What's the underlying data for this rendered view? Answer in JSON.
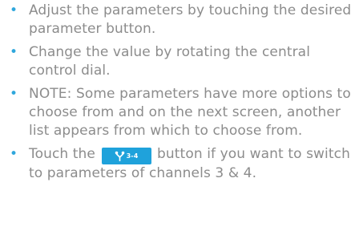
{
  "colors": {
    "text": "#8c8c8c",
    "bullet": "#2fa7dc",
    "button_bg": "#1fa2db",
    "button_fg": "#ffffff"
  },
  "bullets": [
    {
      "text": "Adjust the parameters by touching the desired parameter button."
    },
    {
      "text": "Change the value by rotating the central control dial."
    },
    {
      "text": "NOTE: Some parameters have more options to choose from and on the next screen, another list appears from which to choose from."
    },
    {
      "text_before": "Touch the",
      "button": {
        "icon": "channel-switch-icon",
        "label": "3-4"
      },
      "text_after": "button if you want to switch to parameters of channels 3 & 4."
    }
  ]
}
